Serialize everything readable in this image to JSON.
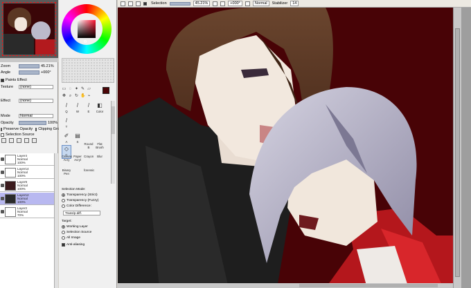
{
  "colors": {
    "canvas_bg": "#480306",
    "hair_brown": "#5b3a26",
    "hair_silver": "#b9b7c9",
    "skin": "#f1e7dc",
    "sweater": "#1e1e1e",
    "scarf_red": "#c01a1f",
    "wheel_selected": "#4a0406",
    "selected_layer": "#b8b8f0"
  },
  "left_panel": {
    "zoom_label": "Zoom",
    "zoom_value": "45.21%",
    "angle_label": "Angle",
    "angle_value": "+000°",
    "paper_effect": "Paints Effect",
    "texture_label": "Texture",
    "texture_value": "(none)",
    "effect_label": "Effect",
    "effect_value": "(none)",
    "mode_label": "Mode",
    "mode_value": "Normal",
    "opacity_label": "Opacity",
    "opacity_value": "100%",
    "preserve_opacity": "Preserve Opacity",
    "clipping_group": "Clipping Group",
    "selection_source": "Selection Source",
    "layers": [
      {
        "name": "Layer4",
        "mode": "Normal",
        "opacity": "100%",
        "selected": false
      },
      {
        "name": "Layer14",
        "mode": "Normal",
        "opacity": "100%",
        "selected": false
      },
      {
        "name": "Layer9",
        "mode": "Normal",
        "opacity": "100%",
        "selected": false
      },
      {
        "name": "Layer12",
        "mode": "Normal",
        "opacity": "100%",
        "selected": true
      },
      {
        "name": "Layer2",
        "mode": "Normal",
        "opacity": "70%",
        "selected": false
      }
    ]
  },
  "toolbar": {
    "selection_label": "Selection",
    "zoom_value": "45.21%",
    "angle_value": "+000°",
    "mode_value": "Normal",
    "stabilizer_label": "Stabilizer",
    "stabilizer_value": "14"
  },
  "tools": {
    "letters": [
      "Q",
      "W",
      "E",
      "R",
      "T",
      "Y",
      "U",
      "I",
      "O",
      "A",
      "S",
      "D",
      "F",
      "G",
      "C"
    ],
    "brushes": [
      {
        "label": "Canvas Acry",
        "icon": "brush-icon"
      },
      {
        "label": "Paper Acryl",
        "icon": "brush-icon"
      },
      {
        "label": "Crayon",
        "icon": "crayon-icon"
      },
      {
        "label": "Blur",
        "icon": "blur-icon"
      },
      {
        "label": "Round B",
        "icon": "brush-icon"
      },
      {
        "label": "Flat Brush",
        "icon": "brush-icon"
      },
      {
        "label": "Binary Pen",
        "icon": "pen-icon"
      },
      {
        "label": "Eraser",
        "icon": "eraser-icon"
      },
      {
        "label": "forensic",
        "icon": "brush-icon"
      },
      {
        "label": "Color",
        "icon": "bucket-icon"
      }
    ],
    "selection_mode_label": "Selection Mode:",
    "mode_options": [
      "Transparency (Strict)",
      "Transparency (Fuzzy)",
      "Color Difference:"
    ],
    "color_diff_value": "Trans/p diff.",
    "target_label": "Target:",
    "target_options": [
      "Working Layer",
      "Selection Source",
      "All Image"
    ],
    "antialias_label": "Anti-aliasing"
  }
}
